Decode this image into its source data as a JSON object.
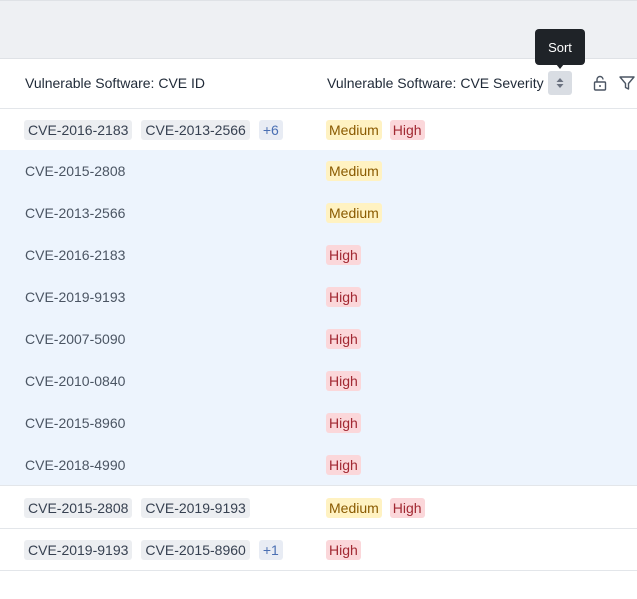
{
  "table": {
    "columns": [
      {
        "label": "Vulnerable Software: CVE ID"
      },
      {
        "label": "Vulnerable Software: CVE Severity"
      }
    ],
    "sort_tooltip": "Sort",
    "groups": [
      {
        "cve_chips": [
          "CVE-2016-2183",
          "CVE-2013-2566"
        ],
        "more": "+6",
        "severities": [
          "Medium",
          "High"
        ]
      },
      {
        "cve_chips": [
          "CVE-2015-2808",
          "CVE-2019-9193"
        ],
        "more": "",
        "severities": [
          "Medium",
          "High"
        ]
      },
      {
        "cve_chips": [
          "CVE-2019-9193",
          "CVE-2015-8960"
        ],
        "more": "+1",
        "severities": [
          "High"
        ]
      }
    ],
    "detail_rows": [
      {
        "cve": "CVE-2015-2808",
        "severity": "Medium"
      },
      {
        "cve": "CVE-2013-2566",
        "severity": "Medium"
      },
      {
        "cve": "CVE-2016-2183",
        "severity": "High"
      },
      {
        "cve": "CVE-2019-9193",
        "severity": "High"
      },
      {
        "cve": "CVE-2007-5090",
        "severity": "High"
      },
      {
        "cve": "CVE-2010-0840",
        "severity": "High"
      },
      {
        "cve": "CVE-2015-8960",
        "severity": "High"
      },
      {
        "cve": "CVE-2018-4990",
        "severity": "High"
      }
    ]
  },
  "icons": {
    "sort": "sort-icon",
    "lock": "unlock-icon",
    "filter": "filter-icon"
  },
  "colors": {
    "detail_row_bg": "#edf4fd",
    "medium_bg": "#fff2c2",
    "high_bg": "#fbd7da",
    "tooltip_bg": "#1f2328"
  }
}
